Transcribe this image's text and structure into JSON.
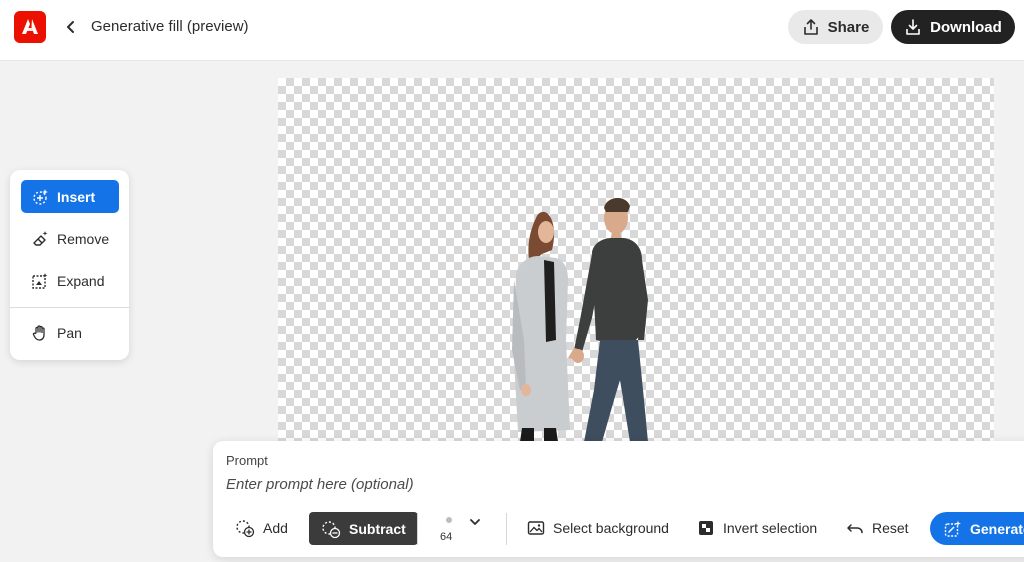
{
  "header": {
    "logo_icon": "adobe-express-logo",
    "back_icon": "chevron-left-icon",
    "title": "Generative fill (preview)",
    "share_label": "Share",
    "download_label": "Download"
  },
  "tools": {
    "items": [
      {
        "label": "Insert",
        "icon": "insert-sparkle-icon",
        "active": true
      },
      {
        "label": "Remove",
        "icon": "eraser-icon",
        "active": false
      },
      {
        "label": "Expand",
        "icon": "expand-icon",
        "active": false
      },
      {
        "label": "Pan",
        "icon": "hand-icon",
        "active": false
      }
    ]
  },
  "prompt": {
    "label": "Prompt",
    "placeholder": "Enter prompt here (optional)",
    "value": ""
  },
  "selection": {
    "add_label": "Add",
    "subtract_label": "Subtract",
    "brush_size": "64",
    "select_background_label": "Select background",
    "invert_selection_label": "Invert selection",
    "reset_label": "Reset",
    "generate_label": "Generate"
  },
  "colors": {
    "accent": "#1473e6",
    "brand": "#eb1000",
    "dark_button": "#222222"
  }
}
